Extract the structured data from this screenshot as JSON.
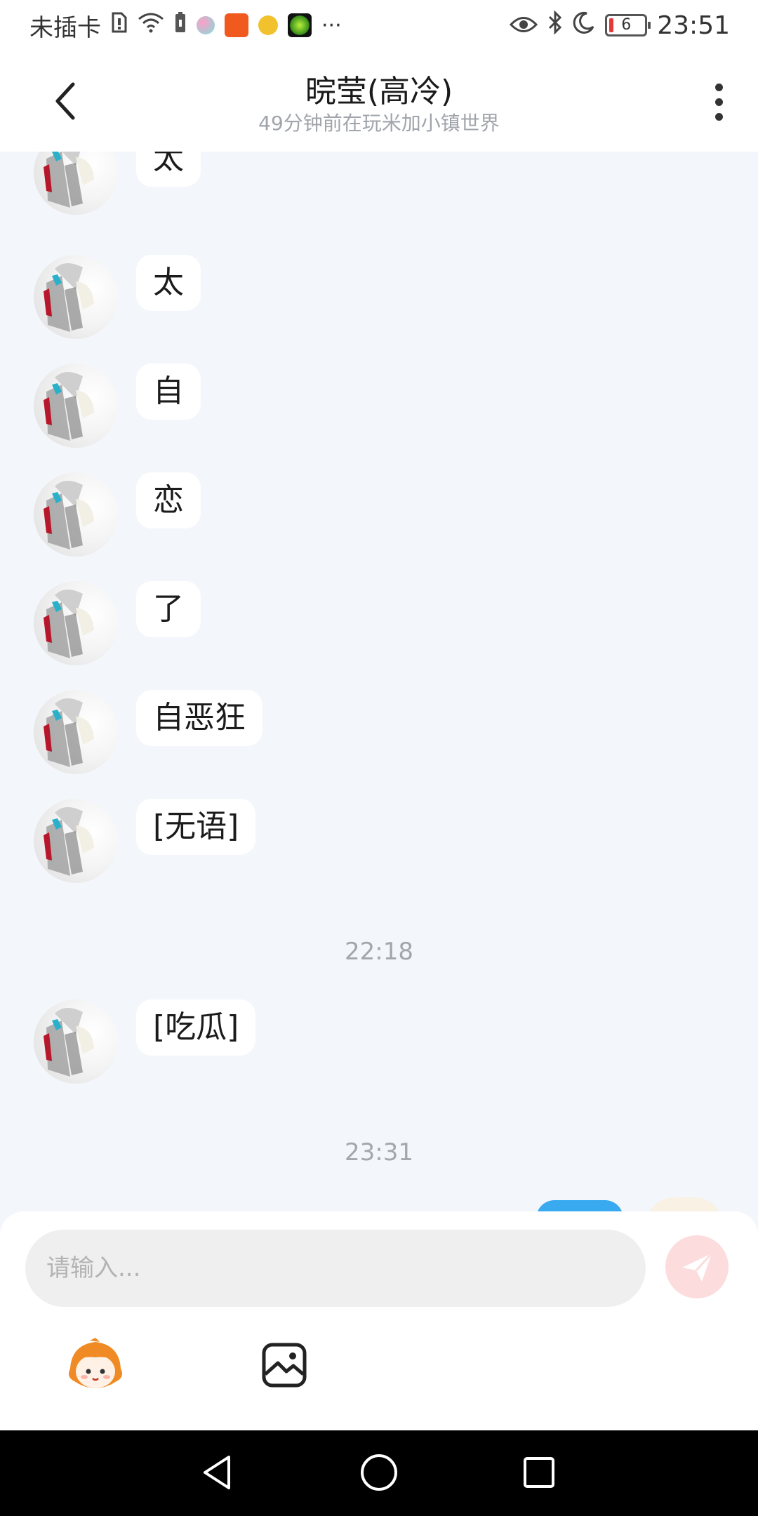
{
  "status_bar": {
    "carrier": "未插卡",
    "time": "23:51",
    "battery_level": "6",
    "overflow": "···",
    "icons": [
      "sim-icon",
      "wifi-icon",
      "battery-small-icon",
      "app-icon-pink",
      "app-icon-orange",
      "app-icon-yellow",
      "app-icon-green",
      "eye-icon",
      "bluetooth-icon",
      "moon-icon",
      "battery-icon"
    ],
    "colors": {
      "app_orange": "#f05a1e",
      "app_yellow": "#f2c12e",
      "app_green": "#6ad13c",
      "battery_low": "#e53935"
    }
  },
  "header": {
    "title": "晥莹(高冷)",
    "subtitle": "49分钟前在玩米加小镇世界",
    "back_icon": "chevron-left-icon",
    "more_icon": "more-vertical-icon"
  },
  "chat": {
    "messages": [
      {
        "sender": "other",
        "text": "太"
      },
      {
        "sender": "other",
        "text": "太"
      },
      {
        "sender": "other",
        "text": "自"
      },
      {
        "sender": "other",
        "text": "恋"
      },
      {
        "sender": "other",
        "text": "了"
      },
      {
        "sender": "other",
        "text": "自恶狂"
      },
      {
        "sender": "other",
        "text": "[无语]"
      },
      {
        "type": "time",
        "text": "22:18"
      },
      {
        "sender": "other",
        "text": "[吃瓜]"
      },
      {
        "type": "time",
        "text": "23:31"
      }
    ],
    "colors": {
      "self_bubble": "#3aaaf0",
      "bubble": "#ffffff",
      "background": "#f3f6fa"
    }
  },
  "input": {
    "placeholder": "请输入...",
    "send_icon": "send-icon",
    "tools": [
      "emoji-mascot-icon",
      "image-icon"
    ],
    "colors": {
      "send_button": "#fcdcdc"
    }
  },
  "nav": {
    "buttons": [
      "back-triangle-icon",
      "home-circle-icon",
      "recents-square-icon"
    ]
  }
}
